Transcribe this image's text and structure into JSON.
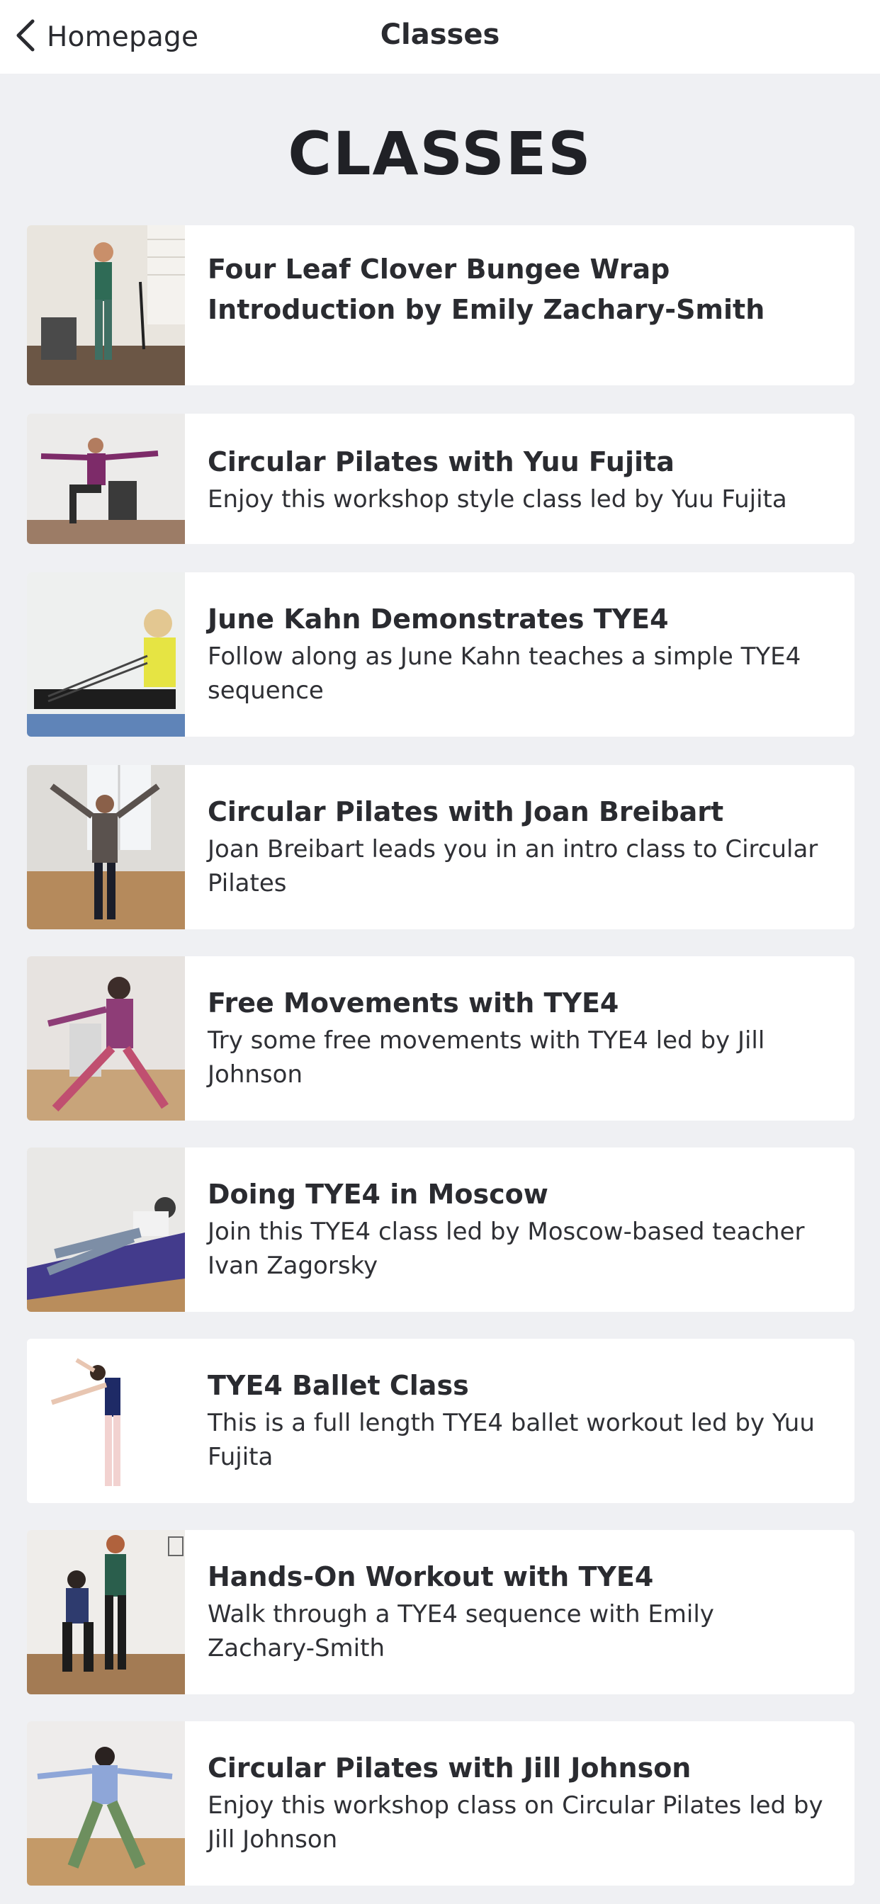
{
  "navbar": {
    "back_label": "Homepage",
    "title": "Classes",
    "back_icon": "chevron-left-icon"
  },
  "page": {
    "heading": "CLASSES"
  },
  "classes": [
    {
      "title": "Four Leaf Clover Bungee Wrap Introduction by Emily Zachary-Smith",
      "description": "",
      "thumbnail": "bungee-wrap-thumbnail"
    },
    {
      "title": "Circular Pilates with Yuu Fujita",
      "description": "Enjoy this workshop style class led by Yuu Fujita",
      "thumbnail": "chair-stretch-thumbnail"
    },
    {
      "title": "June Kahn Demonstrates TYE4",
      "description": "Follow along as June Kahn teaches a simple TYE4 sequence",
      "thumbnail": "seated-band-thumbnail"
    },
    {
      "title": "Circular Pilates with Joan Breibart",
      "description": "Joan Breibart leads you in an intro class to Circular Pilates",
      "thumbnail": "standing-arms-thumbnail"
    },
    {
      "title": "Free Movements with TYE4",
      "description": "Try some free movements with TYE4 led by Jill Johnson",
      "thumbnail": "lunge-thumbnail"
    },
    {
      "title": "Doing TYE4 in Moscow",
      "description": "Join this TYE4 class led by Moscow-based teacher Ivan Zagorsky",
      "thumbnail": "mat-side-lying-thumbnail"
    },
    {
      "title": "TYE4 Ballet Class",
      "description": "This is a full length TYE4 ballet workout led by Yuu Fujita",
      "thumbnail": "ballet-thumbnail"
    },
    {
      "title": "Hands-On Workout with TYE4",
      "description": "Walk through a TYE4 sequence with Emily Zachary-Smith",
      "thumbnail": "hands-on-thumbnail"
    },
    {
      "title": "Circular Pilates with Jill Johnson",
      "description": "Enjoy this workshop class on Circular Pilates led by Jill Johnson",
      "thumbnail": "wide-squat-thumbnail"
    }
  ],
  "colors": {
    "background": "#eff0f3",
    "card": "#ffffff",
    "text": "#2a2b30"
  }
}
